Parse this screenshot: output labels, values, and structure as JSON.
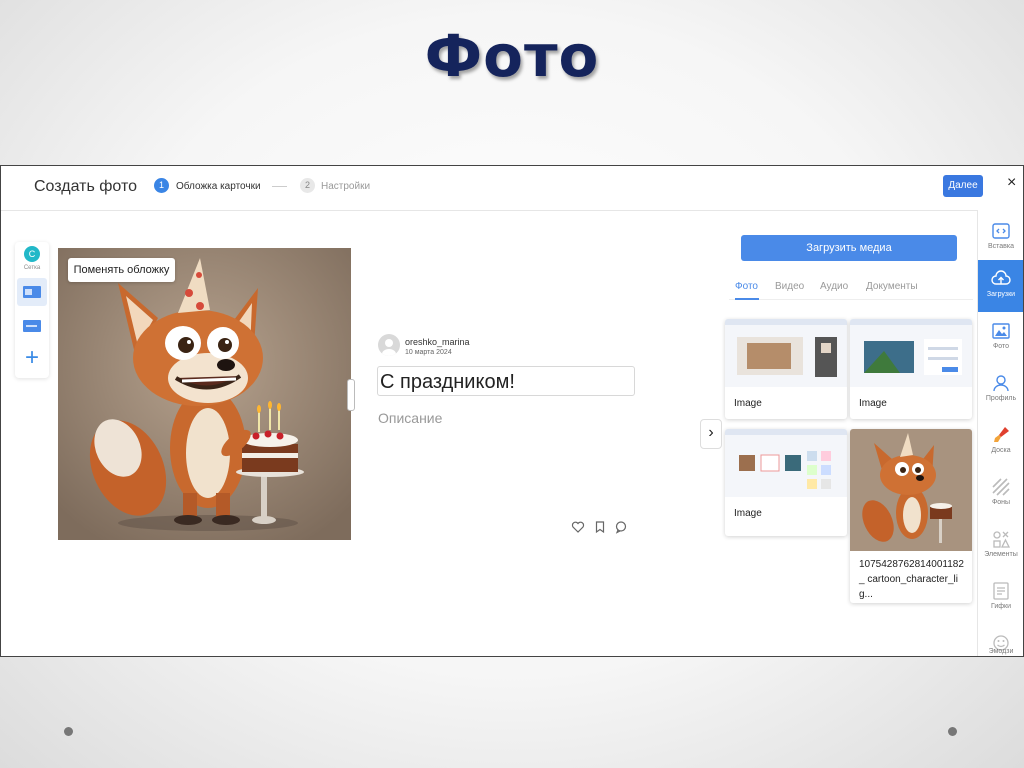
{
  "slide": {
    "title": "Фото"
  },
  "header": {
    "title": "Создать фото",
    "steps": [
      {
        "num": "1",
        "label": "Обложка карточки"
      },
      {
        "num": "2",
        "label": "Настройки"
      }
    ],
    "next_label": "Далее",
    "close": "×"
  },
  "left_tools": {
    "c_letter": "C",
    "c_label": "Сетка",
    "plus": "+"
  },
  "cover": {
    "change_label": "Поменять обложку"
  },
  "post": {
    "author": "oreshko_marina",
    "date": "10 марта 2024",
    "title": "С праздником!",
    "description_placeholder": "Описание"
  },
  "media": {
    "upload_label": "Загрузить медиа",
    "tabs": [
      "Фото",
      "Видео",
      "Аудио",
      "Документы"
    ],
    "items": [
      {
        "label": "Image"
      },
      {
        "label": "Image"
      },
      {
        "label": "Image"
      },
      {
        "label": "1075428762814001182_ cartoon_character_lig..."
      }
    ],
    "arrow": "›"
  },
  "right_rail": [
    {
      "label": "Вставка",
      "icon": "code-icon"
    },
    {
      "label": "Загрузки",
      "icon": "upload-cloud-icon"
    },
    {
      "label": "Фото",
      "icon": "image-icon"
    },
    {
      "label": "Профиль",
      "icon": "person-icon"
    },
    {
      "label": "Доска",
      "icon": "brush-icon"
    },
    {
      "label": "Фоны",
      "icon": "stripes-icon"
    },
    {
      "label": "Элементы",
      "icon": "shapes-icon"
    },
    {
      "label": "Гифки",
      "icon": "gif-icon"
    },
    {
      "label": "Эмодзи",
      "icon": "emoji-icon"
    }
  ],
  "colors": {
    "accent": "#3a85e5",
    "title": "#15245c"
  }
}
